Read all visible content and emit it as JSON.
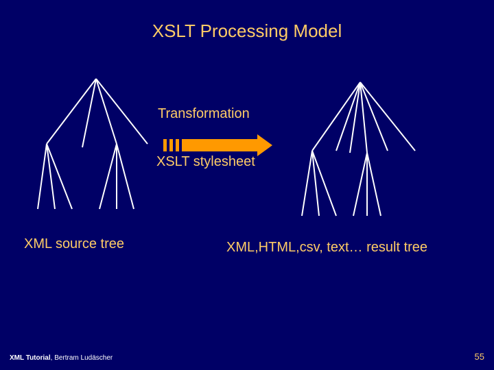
{
  "title": "XSLT Processing Model",
  "labels": {
    "transformation": "Transformation",
    "stylesheet": "XSLT stylesheet",
    "source": "XML source tree",
    "result": "XML,HTML,csv, text… result tree"
  },
  "footer": {
    "title": "XML Tutorial",
    "author": ", Bertram Ludäscher",
    "page": "55"
  }
}
